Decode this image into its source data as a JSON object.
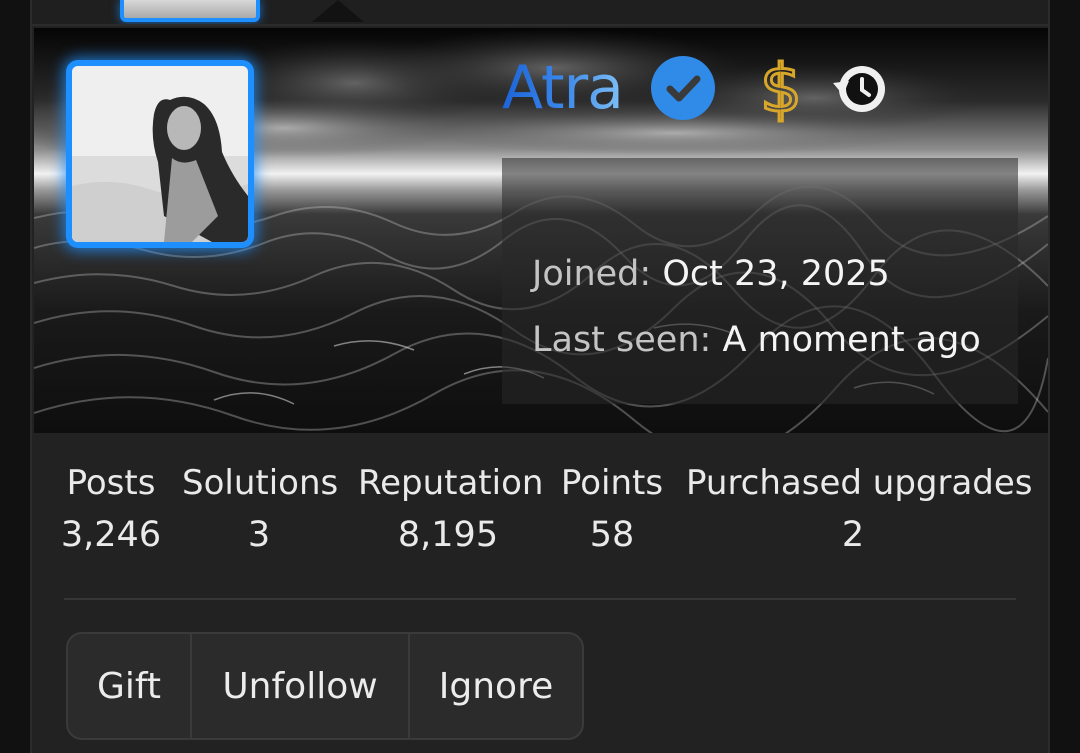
{
  "profile": {
    "username": "Atra",
    "joined_label": "Joined:",
    "joined_value": "Oct 23, 2025",
    "last_seen_label": "Last seen:",
    "last_seen_value": "A moment ago",
    "badges": [
      "verified-check-icon",
      "dollar-sign-icon",
      "history-icon"
    ]
  },
  "stats": [
    {
      "label": "Posts",
      "value": "3,246"
    },
    {
      "label": "Solutions",
      "value": "3"
    },
    {
      "label": "Reputation",
      "value": "8,195"
    },
    {
      "label": "Points",
      "value": "58"
    },
    {
      "label": "Purchased upgrades",
      "value": "2"
    }
  ],
  "actions": {
    "gift": "Gift",
    "unfollow": "Unfollow",
    "ignore": "Ignore"
  },
  "colors": {
    "accent": "#1e8fff",
    "username_gradient_start": "#1c64d8",
    "username_gradient_end": "#7fc0f5",
    "dollar_gold": "#d8a72a",
    "card_bg": "#222222"
  }
}
